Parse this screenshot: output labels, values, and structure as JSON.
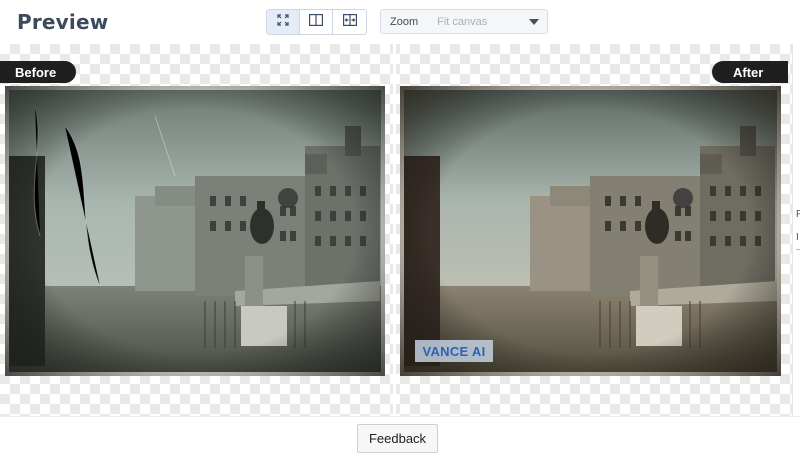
{
  "header": {
    "title": "Preview",
    "view_modes": [
      {
        "name": "fullscreen-icon",
        "active": true
      },
      {
        "name": "split-view-icon",
        "active": false
      },
      {
        "name": "compare-slider-icon",
        "active": false
      }
    ],
    "zoom": {
      "label": "Zoom",
      "value": "Fit canvas"
    }
  },
  "compare": {
    "before_label": "Before",
    "after_label": "After",
    "watermark": "VANCE AI"
  },
  "colors": {
    "badge_bg": "#1f1f1f",
    "title": "#3c4a5c",
    "active_mode_bg": "#e4ecf7",
    "watermark_text": "#2a63b8"
  },
  "side_panel": {
    "letter_1": "F",
    "letter_2": "I"
  },
  "footer": {
    "feedback_label": "Feedback"
  }
}
